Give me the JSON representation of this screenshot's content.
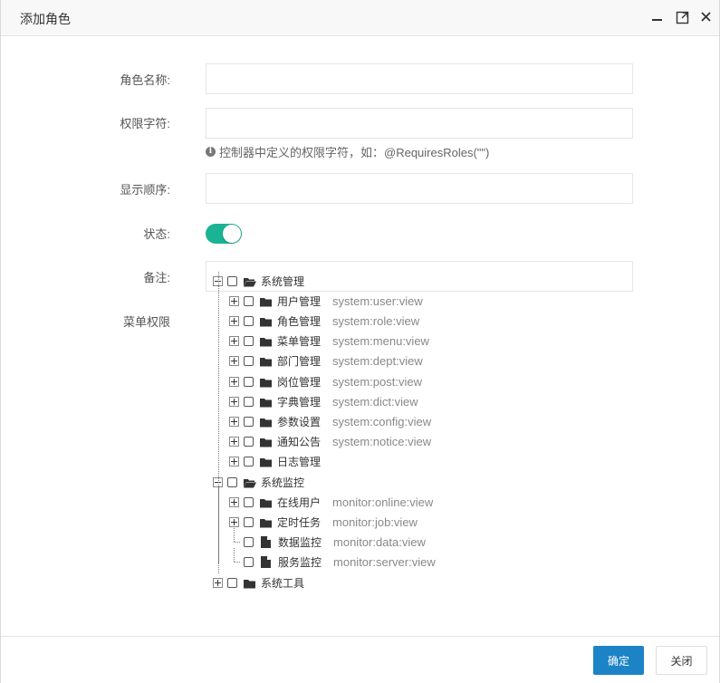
{
  "dialog": {
    "title": "添加角色",
    "controls": {
      "minimize_icon": "minimize-icon",
      "maximize_icon": "maximize-icon",
      "close_icon": "close-icon"
    }
  },
  "form": {
    "role_name": {
      "label": "角色名称:",
      "value": ""
    },
    "permission_string": {
      "label": "权限字符:",
      "value": ""
    },
    "permission_hint": "控制器中定义的权限字符，如：@RequiresRoles(\"\")",
    "display_order": {
      "label": "显示顺序:",
      "value": ""
    },
    "status": {
      "label": "状态:",
      "enabled": true
    },
    "remark": {
      "label": "备注:",
      "value": ""
    },
    "menu_permissions": {
      "label": "菜单权限"
    }
  },
  "menu_tree": [
    {
      "label": "系统管理",
      "expanded": true,
      "children": [
        {
          "label": "用户管理",
          "perm": "system:user:view",
          "type": "folder"
        },
        {
          "label": "角色管理",
          "perm": "system:role:view",
          "type": "folder"
        },
        {
          "label": "菜单管理",
          "perm": "system:menu:view",
          "type": "folder"
        },
        {
          "label": "部门管理",
          "perm": "system:dept:view",
          "type": "folder"
        },
        {
          "label": "岗位管理",
          "perm": "system:post:view",
          "type": "folder"
        },
        {
          "label": "字典管理",
          "perm": "system:dict:view",
          "type": "folder"
        },
        {
          "label": "参数设置",
          "perm": "system:config:view",
          "type": "folder"
        },
        {
          "label": "通知公告",
          "perm": "system:notice:view",
          "type": "folder"
        },
        {
          "label": "日志管理",
          "perm": "",
          "type": "folder"
        }
      ]
    },
    {
      "label": "系统监控",
      "expanded": true,
      "children": [
        {
          "label": "在线用户",
          "perm": "monitor:online:view",
          "type": "folder"
        },
        {
          "label": "定时任务",
          "perm": "monitor:job:view",
          "type": "folder"
        },
        {
          "label": "数据监控",
          "perm": "monitor:data:view",
          "type": "file"
        },
        {
          "label": "服务监控",
          "perm": "monitor:server:view",
          "type": "file"
        }
      ]
    },
    {
      "label": "系统工具",
      "expanded": false,
      "children": []
    }
  ],
  "footer": {
    "ok_label": "确定",
    "cancel_label": "关闭"
  },
  "colors": {
    "primary": "#1c84c6",
    "switch_on": "#1ab394"
  }
}
